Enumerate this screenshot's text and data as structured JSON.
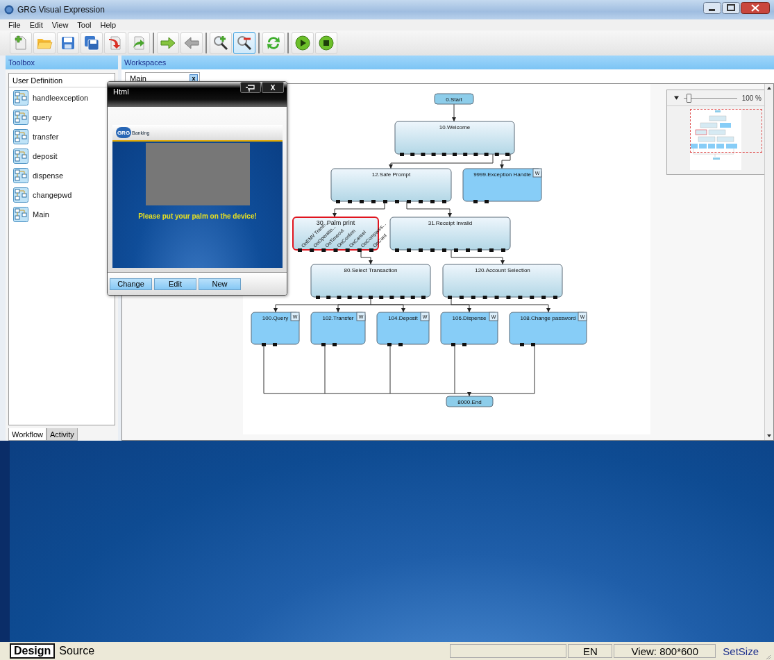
{
  "window": {
    "title": "GRG Visual Expression"
  },
  "menu": [
    "File",
    "Edit",
    "View",
    "Tool",
    "Help"
  ],
  "toolbar": [
    {
      "kind": "new",
      "selected": false
    },
    {
      "kind": "open",
      "selected": false
    },
    {
      "kind": "save",
      "selected": false
    },
    {
      "kind": "save-all",
      "selected": false
    },
    {
      "kind": "import",
      "selected": false
    },
    {
      "kind": "export",
      "selected": false
    },
    {
      "kind": "forward",
      "selected": false
    },
    {
      "kind": "back",
      "selected": false
    },
    {
      "kind": "zoom-in",
      "selected": false
    },
    {
      "kind": "zoom-out",
      "selected": true
    },
    {
      "kind": "refresh",
      "selected": false
    },
    {
      "kind": "run",
      "selected": false
    },
    {
      "kind": "stop",
      "selected": false
    }
  ],
  "toolbox": {
    "title": "Toolbox",
    "dropdown": "User Definition",
    "items": [
      "handleexception",
      "query",
      "transfer",
      "deposit",
      "dispense",
      "changepwd",
      "Main"
    ],
    "tabs": [
      {
        "label": "Workflow",
        "selected": true
      },
      {
        "label": "Activity",
        "selected": false
      }
    ]
  },
  "workspace": {
    "title": "Workspaces",
    "tabs": [
      {
        "label": "Main",
        "close": "x",
        "selected": true
      }
    ],
    "diagram": {
      "nodes": [
        {
          "label": "0.Start",
          "kind": "terminal",
          "selected": false
        },
        {
          "label": "10.Welcome",
          "kind": "step",
          "selected": false
        },
        {
          "label": "12.Safe Prompt",
          "kind": "step",
          "selected": false
        },
        {
          "label": "9999.Exception Handle",
          "kind": "sub",
          "badge": "W",
          "selected": false
        },
        {
          "label": "30. Palm print",
          "kind": "step",
          "selected": true,
          "ports": [
            "OnEMV Trans...",
            "OnOperatio...",
            "OnTimeout",
            "OnConfirm",
            "OnCancel",
            "OnCompares...",
            "OnCard"
          ]
        },
        {
          "label": "31.Receipt Invalid",
          "kind": "step",
          "selected": false
        },
        {
          "label": "80.Select Transaction",
          "kind": "step",
          "selected": false
        },
        {
          "label": "120.Account Selection",
          "kind": "step",
          "selected": false
        },
        {
          "label": "100.Query",
          "kind": "sub",
          "badge": "W",
          "selected": false
        },
        {
          "label": "102.Transfer",
          "kind": "sub",
          "badge": "W",
          "selected": false
        },
        {
          "label": "104.Deposit",
          "kind": "sub",
          "badge": "W",
          "selected": false
        },
        {
          "label": "106.Dispense",
          "kind": "sub",
          "badge": "W",
          "selected": false
        },
        {
          "label": "108.Change password",
          "kind": "sub",
          "badge": "W",
          "selected": false
        },
        {
          "label": "8000.End",
          "kind": "terminal",
          "selected": false
        }
      ]
    },
    "zoom": {
      "reading": "100 %",
      "level": 0.05
    }
  },
  "popup": {
    "title": "Html",
    "close": "X",
    "logo": "GRG",
    "brand": "Banking",
    "message": "Please put your palm on the device!",
    "buttons": [
      "Change",
      "Edit",
      "New"
    ]
  },
  "status_bar": {
    "modes": [
      {
        "label": "Design",
        "selected": true
      },
      {
        "label": "Source",
        "selected": false
      }
    ],
    "language": "EN",
    "view": "View: 800*600",
    "action": "SetSize"
  }
}
